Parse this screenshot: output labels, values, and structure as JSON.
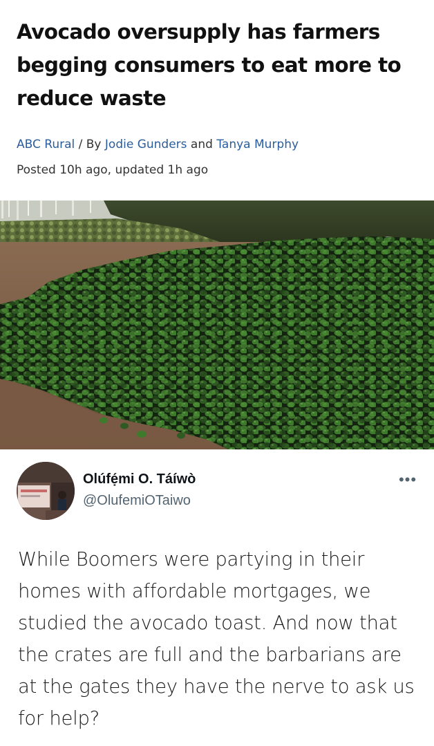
{
  "article": {
    "headline": "Avocado oversupply has farmers begging consumers to eat more to reduce waste",
    "source": "ABC Rural",
    "separator": " / By ",
    "author1": "Jodie Gunders",
    "conjunction": " and ",
    "author2": "Tanya Murphy",
    "posted": "Posted 10h ago, updated 1h ago",
    "image_subject": "pile of discarded green avocados on dirt ground"
  },
  "tweet": {
    "display_name": "Olúfẹ́mi O. Táíwò",
    "handle": "@OlufemiOTaiwo",
    "more_icon": "more-horizontal-icon",
    "more_glyph": "•••",
    "text": "While Boomers were partying in their homes with affordable mortgages, we studied the avocado toast. And now that the crates are full and the barbarians are at the gates they have the nerve to ask us for help?"
  },
  "colors": {
    "link": "#2a5d9c",
    "secondary_text": "#536471",
    "headline": "#111111"
  }
}
